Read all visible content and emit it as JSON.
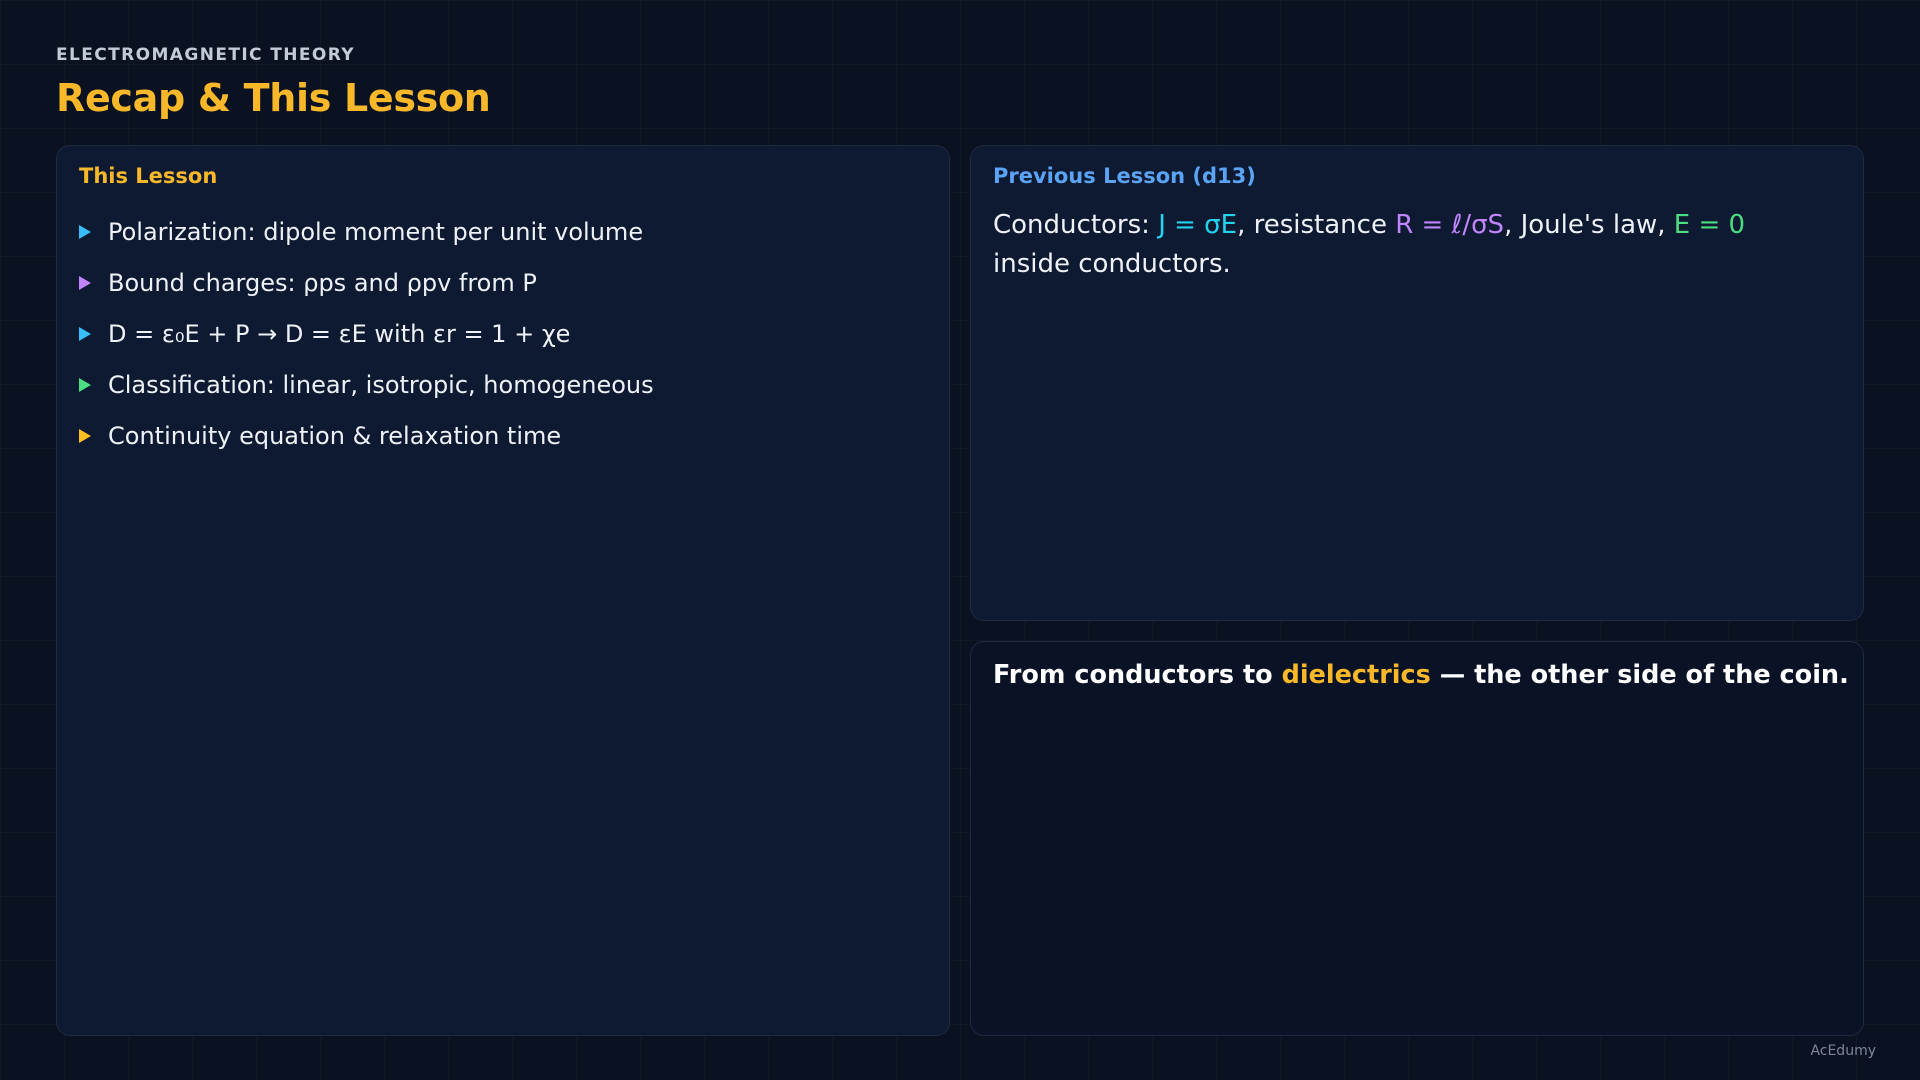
{
  "header": {
    "subject": "ELECTROMAGNETIC THEORY",
    "title": "Recap & This Lesson"
  },
  "this_lesson": {
    "heading": "This Lesson",
    "items": [
      {
        "text": "Polarization: dipole moment per unit volume",
        "color": "#38bdf8"
      },
      {
        "text": "Bound charges: ρps and ρpv from P",
        "color": "#c084fc"
      },
      {
        "text": "D = ε₀E + P → D = εE with εr = 1 + χe",
        "color": "#38bdf8"
      },
      {
        "text": "Classification: linear, isotropic, homogeneous",
        "color": "#4ade80"
      },
      {
        "text": "Continuity equation & relaxation time",
        "color": "#fbbf24"
      }
    ]
  },
  "previous_lesson": {
    "heading": "Previous Lesson (d13)",
    "segments": [
      {
        "text": "Conductors: ",
        "color": "#eef2f8"
      },
      {
        "text": "J = σE",
        "color": "#22d3ee"
      },
      {
        "text": ", resistance ",
        "color": "#eef2f8"
      },
      {
        "text": "R = ℓ/σS",
        "color": "#c084fc"
      },
      {
        "text": ", Joule's law, ",
        "color": "#eef2f8"
      },
      {
        "text": "E = 0",
        "color": "#4ade80"
      },
      {
        "text": " inside conductors.",
        "color": "#eef2f8"
      }
    ]
  },
  "bridge": {
    "segments": [
      {
        "text": "From conductors to ",
        "color": "#ffffff"
      },
      {
        "text": "dielectrics",
        "color": "#f9b82a"
      },
      {
        "text": " — the other side of the coin.",
        "color": "#ffffff"
      }
    ]
  },
  "brand": "AcEdumy"
}
